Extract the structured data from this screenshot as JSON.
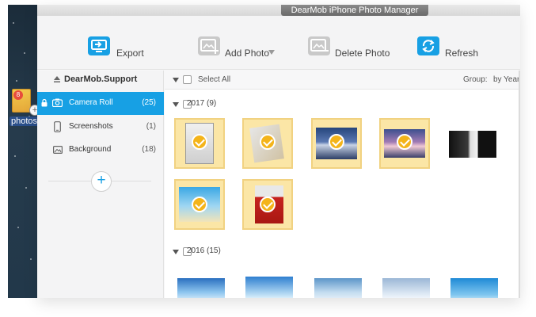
{
  "window": {
    "title": "DearMob iPhone Photo Manager"
  },
  "desktop": {
    "icon_label": "photos",
    "icon_badge": "8"
  },
  "toolbar": {
    "export": "Export",
    "add_photo": "Add Photo",
    "delete_photo": "Delete Photo",
    "refresh": "Refresh"
  },
  "sidebar": {
    "device": "DearMob.Support",
    "items": [
      {
        "label": "Camera Roll",
        "count": "(25)"
      },
      {
        "label": "Screenshots",
        "count": "(1)"
      },
      {
        "label": "Background",
        "count": "(18)"
      }
    ]
  },
  "content": {
    "select_all": "Select All",
    "group_label": "Group:",
    "group_value": "by Year",
    "sections": [
      {
        "label": "2017 (9)"
      },
      {
        "label": "2016 (15)"
      }
    ]
  },
  "colors": {
    "accent": "#17a0e4",
    "selection": "#f4b41a",
    "selection_bg": "#fbe6a6"
  }
}
